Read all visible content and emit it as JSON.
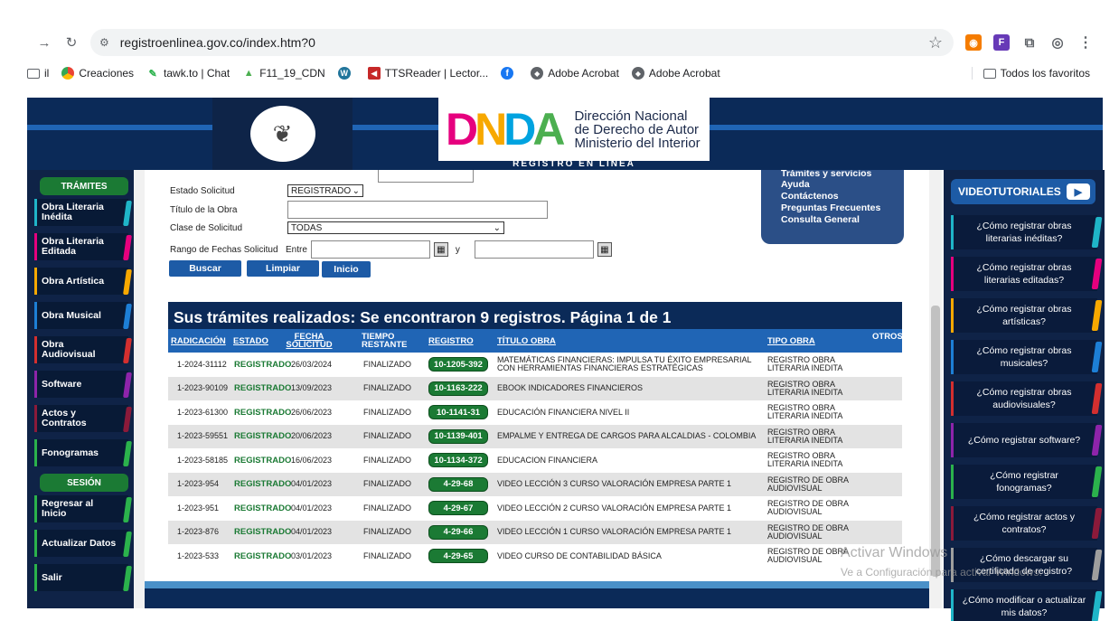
{
  "browser": {
    "url": "registroenlinea.gov.co/index.htm?0",
    "bookmarks": [
      {
        "label": "il",
        "icon": "folder-icon"
      },
      {
        "label": "Creaciones",
        "icon": "chrome-icon"
      },
      {
        "label": "tawk.to | Chat",
        "icon": "tawk-icon"
      },
      {
        "label": "F11_19_CDN",
        "icon": "drive-icon"
      },
      {
        "label": "",
        "icon": "wordpress-icon"
      },
      {
        "label": "TTSReader | Lector...",
        "icon": "ttsreader-icon"
      },
      {
        "label": "",
        "icon": "facebook-icon"
      },
      {
        "label": "Adobe Acrobat",
        "icon": "adobe-icon"
      },
      {
        "label": "Adobe Acrobat",
        "icon": "adobe-icon"
      }
    ],
    "all_bookmarks": "Todos los favoritos"
  },
  "header": {
    "logo_letters": [
      "D",
      "N",
      "D",
      "A"
    ],
    "org_line1": "Dirección Nacional",
    "org_line2": "de Derecho de Autor",
    "org_line3": "Ministerio del Interior",
    "subtitle": "REGISTRO EN LÍNEA"
  },
  "left_sidebar": {
    "tramites_heading": "TRÁMITES",
    "tramites": [
      {
        "label": "Obra Literaria Inédita",
        "color": "#1fb5c8"
      },
      {
        "label": "Obra Literaria Editada",
        "color": "#e6007e"
      },
      {
        "label": "Obra Artística",
        "color": "#f7a800"
      },
      {
        "label": "Obra Musical",
        "color": "#1d7fd6"
      },
      {
        "label": "Obra Audiovisual",
        "color": "#d32f2f"
      },
      {
        "label": "Software",
        "color": "#8e24aa"
      },
      {
        "label": "Actos y Contratos",
        "color": "#8b1a3a"
      },
      {
        "label": "Fonogramas",
        "color": "#2bb24c"
      }
    ],
    "sesion_heading": "SESIÓN",
    "sesion": [
      {
        "label": "Regresar al Inicio",
        "color": "#2bb24c"
      },
      {
        "label": "Actualizar Datos",
        "color": "#2bb24c"
      },
      {
        "label": "Salir",
        "color": "#2bb24c"
      }
    ]
  },
  "form": {
    "estado_label": "Estado Solicitud",
    "estado_value": "REGISTRADO",
    "titulo_label": "Título de la Obra",
    "titulo_value": "",
    "clase_label": "Clase de Solicitud",
    "clase_value": "TODAS",
    "rango_label": "Rango de Fechas Solicitud",
    "entre_label": "Entre",
    "y_label": "y",
    "buscar": "Buscar",
    "limpiar": "Limpiar",
    "inicio": "Inicio"
  },
  "top_menu": {
    "items": [
      "Trámites y servicios",
      "Ayuda",
      "Contáctenos",
      "Preguntas Frecuentes",
      "Consulta General"
    ]
  },
  "results": {
    "title": "Sus trámites realizados: Se encontraron 9 registros. Página 1 de 1",
    "headers": {
      "radicacion": "RADICACIÓN",
      "estado": "ESTADO",
      "fecha": "FECHA SOLICITUD",
      "tiempo": "TIEMPO RESTANTE",
      "registro": "REGISTRO",
      "titulo": "TÍTULO OBRA",
      "tipo": "TIPO OBRA",
      "otros": "OTROS"
    },
    "rows": [
      {
        "radicacion": "1-2024-31112",
        "estado": "REGISTRADO",
        "fecha": "26/03/2024",
        "tiempo": "FINALIZADO",
        "registro": "10-1205-392",
        "titulo": "MATEMÁTICAS FINANCIERAS: IMPULSA TU ÉXITO EMPRESARIAL CON HERRAMIENTAS FINANCIERAS ESTRATÉGICAS",
        "tipo": "REGISTRO OBRA LITERARIA INEDITA"
      },
      {
        "radicacion": "1-2023-90109",
        "estado": "REGISTRADO",
        "fecha": "13/09/2023",
        "tiempo": "FINALIZADO",
        "registro": "10-1163-222",
        "titulo": "EBOOK INDICADORES FINANCIEROS",
        "tipo": "REGISTRO OBRA LITERARIA INEDITA"
      },
      {
        "radicacion": "1-2023-61300",
        "estado": "REGISTRADO",
        "fecha": "26/06/2023",
        "tiempo": "FINALIZADO",
        "registro": "10-1141-31",
        "titulo": "EDUCACIÓN FINANCIERA NIVEL II",
        "tipo": "REGISTRO OBRA LITERARIA INEDITA"
      },
      {
        "radicacion": "1-2023-59551",
        "estado": "REGISTRADO",
        "fecha": "20/06/2023",
        "tiempo": "FINALIZADO",
        "registro": "10-1139-401",
        "titulo": "EMPALME Y ENTREGA DE CARGOS PARA ALCALDIAS - COLOMBIA",
        "tipo": "REGISTRO OBRA LITERARIA INEDITA"
      },
      {
        "radicacion": "1-2023-58185",
        "estado": "REGISTRADO",
        "fecha": "16/06/2023",
        "tiempo": "FINALIZADO",
        "registro": "10-1134-372",
        "titulo": "EDUCACION FINANCIERA",
        "tipo": "REGISTRO OBRA LITERARIA INEDITA"
      },
      {
        "radicacion": "1-2023-954",
        "estado": "REGISTRADO",
        "fecha": "04/01/2023",
        "tiempo": "FINALIZADO",
        "registro": "4-29-68",
        "titulo": "VIDEO LECCIÓN 3 CURSO VALORACIÓN EMPRESA PARTE 1",
        "tipo": "REGISTRO DE OBRA AUDIOVISUAL"
      },
      {
        "radicacion": "1-2023-951",
        "estado": "REGISTRADO",
        "fecha": "04/01/2023",
        "tiempo": "FINALIZADO",
        "registro": "4-29-67",
        "titulo": "VIDEO LECCIÓN 2 CURSO VALORACIÓN EMPRESA PARTE 1",
        "tipo": "REGISTRO DE OBRA AUDIOVISUAL"
      },
      {
        "radicacion": "1-2023-876",
        "estado": "REGISTRADO",
        "fecha": "04/01/2023",
        "tiempo": "FINALIZADO",
        "registro": "4-29-66",
        "titulo": "VIDEO LECCIÓN 1 CURSO VALORACIÓN EMPRESA PARTE 1",
        "tipo": "REGISTRO DE OBRA AUDIOVISUAL"
      },
      {
        "radicacion": "1-2023-533",
        "estado": "REGISTRADO",
        "fecha": "03/01/2023",
        "tiempo": "FINALIZADO",
        "registro": "4-29-65",
        "titulo": "VIDEO CURSO DE CONTABILIDAD BÁSICA",
        "tipo": "REGISTRO DE OBRA AUDIOVISUAL"
      }
    ]
  },
  "videotutoriales": {
    "title": "VIDEOTUTORIALES",
    "items": [
      {
        "label": "¿Cómo registrar obras literarias inéditas?",
        "color": "#1fb5c8"
      },
      {
        "label": "¿Cómo registrar obras literarias editadas?",
        "color": "#e6007e"
      },
      {
        "label": "¿Cómo registrar obras artísticas?",
        "color": "#f7a800"
      },
      {
        "label": "¿Cómo registrar obras musicales?",
        "color": "#1d7fd6"
      },
      {
        "label": "¿Cómo registrar obras audiovisuales?",
        "color": "#d32f2f"
      },
      {
        "label": "¿Cómo registrar software?",
        "color": "#8e24aa"
      },
      {
        "label": "¿Cómo registrar fonogramas?",
        "color": "#2bb24c"
      },
      {
        "label": "¿Cómo registrar actos y contratos?",
        "color": "#8b1a3a"
      },
      {
        "label": "¿Cómo descargar su certificado de registro?",
        "color": "#9e9e9e"
      },
      {
        "label": "¿Cómo modificar o actualizar mis datos?",
        "color": "#1fb5c8"
      }
    ]
  },
  "watermark": {
    "line1": "Activar Windows",
    "line2": "Ve a Configuración para activar Windows."
  }
}
